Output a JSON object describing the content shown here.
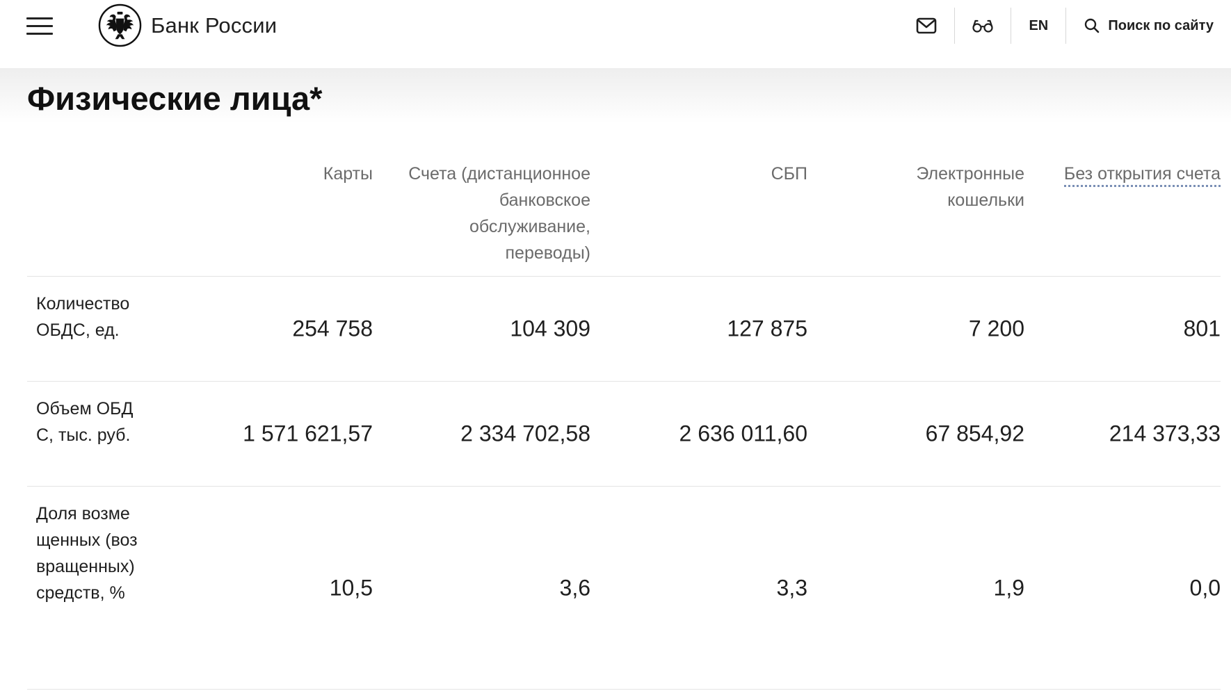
{
  "header": {
    "menu_icon": "hamburger-menu-icon",
    "brand": "Банк России",
    "mail_icon": "envelope-icon",
    "vision_icon": "glasses-icon",
    "lang": "EN",
    "search_icon": "search-icon",
    "search_label": "Поиск по сайту"
  },
  "page": {
    "title": "Физические лица*"
  },
  "table": {
    "columns": [
      "Карты",
      "Счета (дистанционное банковское обслуживание, переводы)",
      "СБП",
      "Электронные кошельки",
      "Без открытия счета"
    ],
    "rows": [
      {
        "label": "Количество ОБДС, ед.",
        "values": [
          "254 758",
          "104 309",
          "127 875",
          "7 200",
          "801"
        ]
      },
      {
        "label": "Объем ОБДС, тыс. руб.",
        "values": [
          "1 571 621,57",
          "2 334 702,58",
          "2 636 011,60",
          "67 854,92",
          "214 373,33"
        ]
      },
      {
        "label": "Доля возмещенных (возвращенных) средств, %",
        "values": [
          "10,5",
          "3,6",
          "3,3",
          "1,9",
          "0,0"
        ]
      }
    ]
  },
  "colors": {
    "text": "#1f1f1f",
    "muted_header": "#6b6b6b",
    "dotted_link": "#7a8fb5",
    "divider": "#e4e4e4"
  }
}
